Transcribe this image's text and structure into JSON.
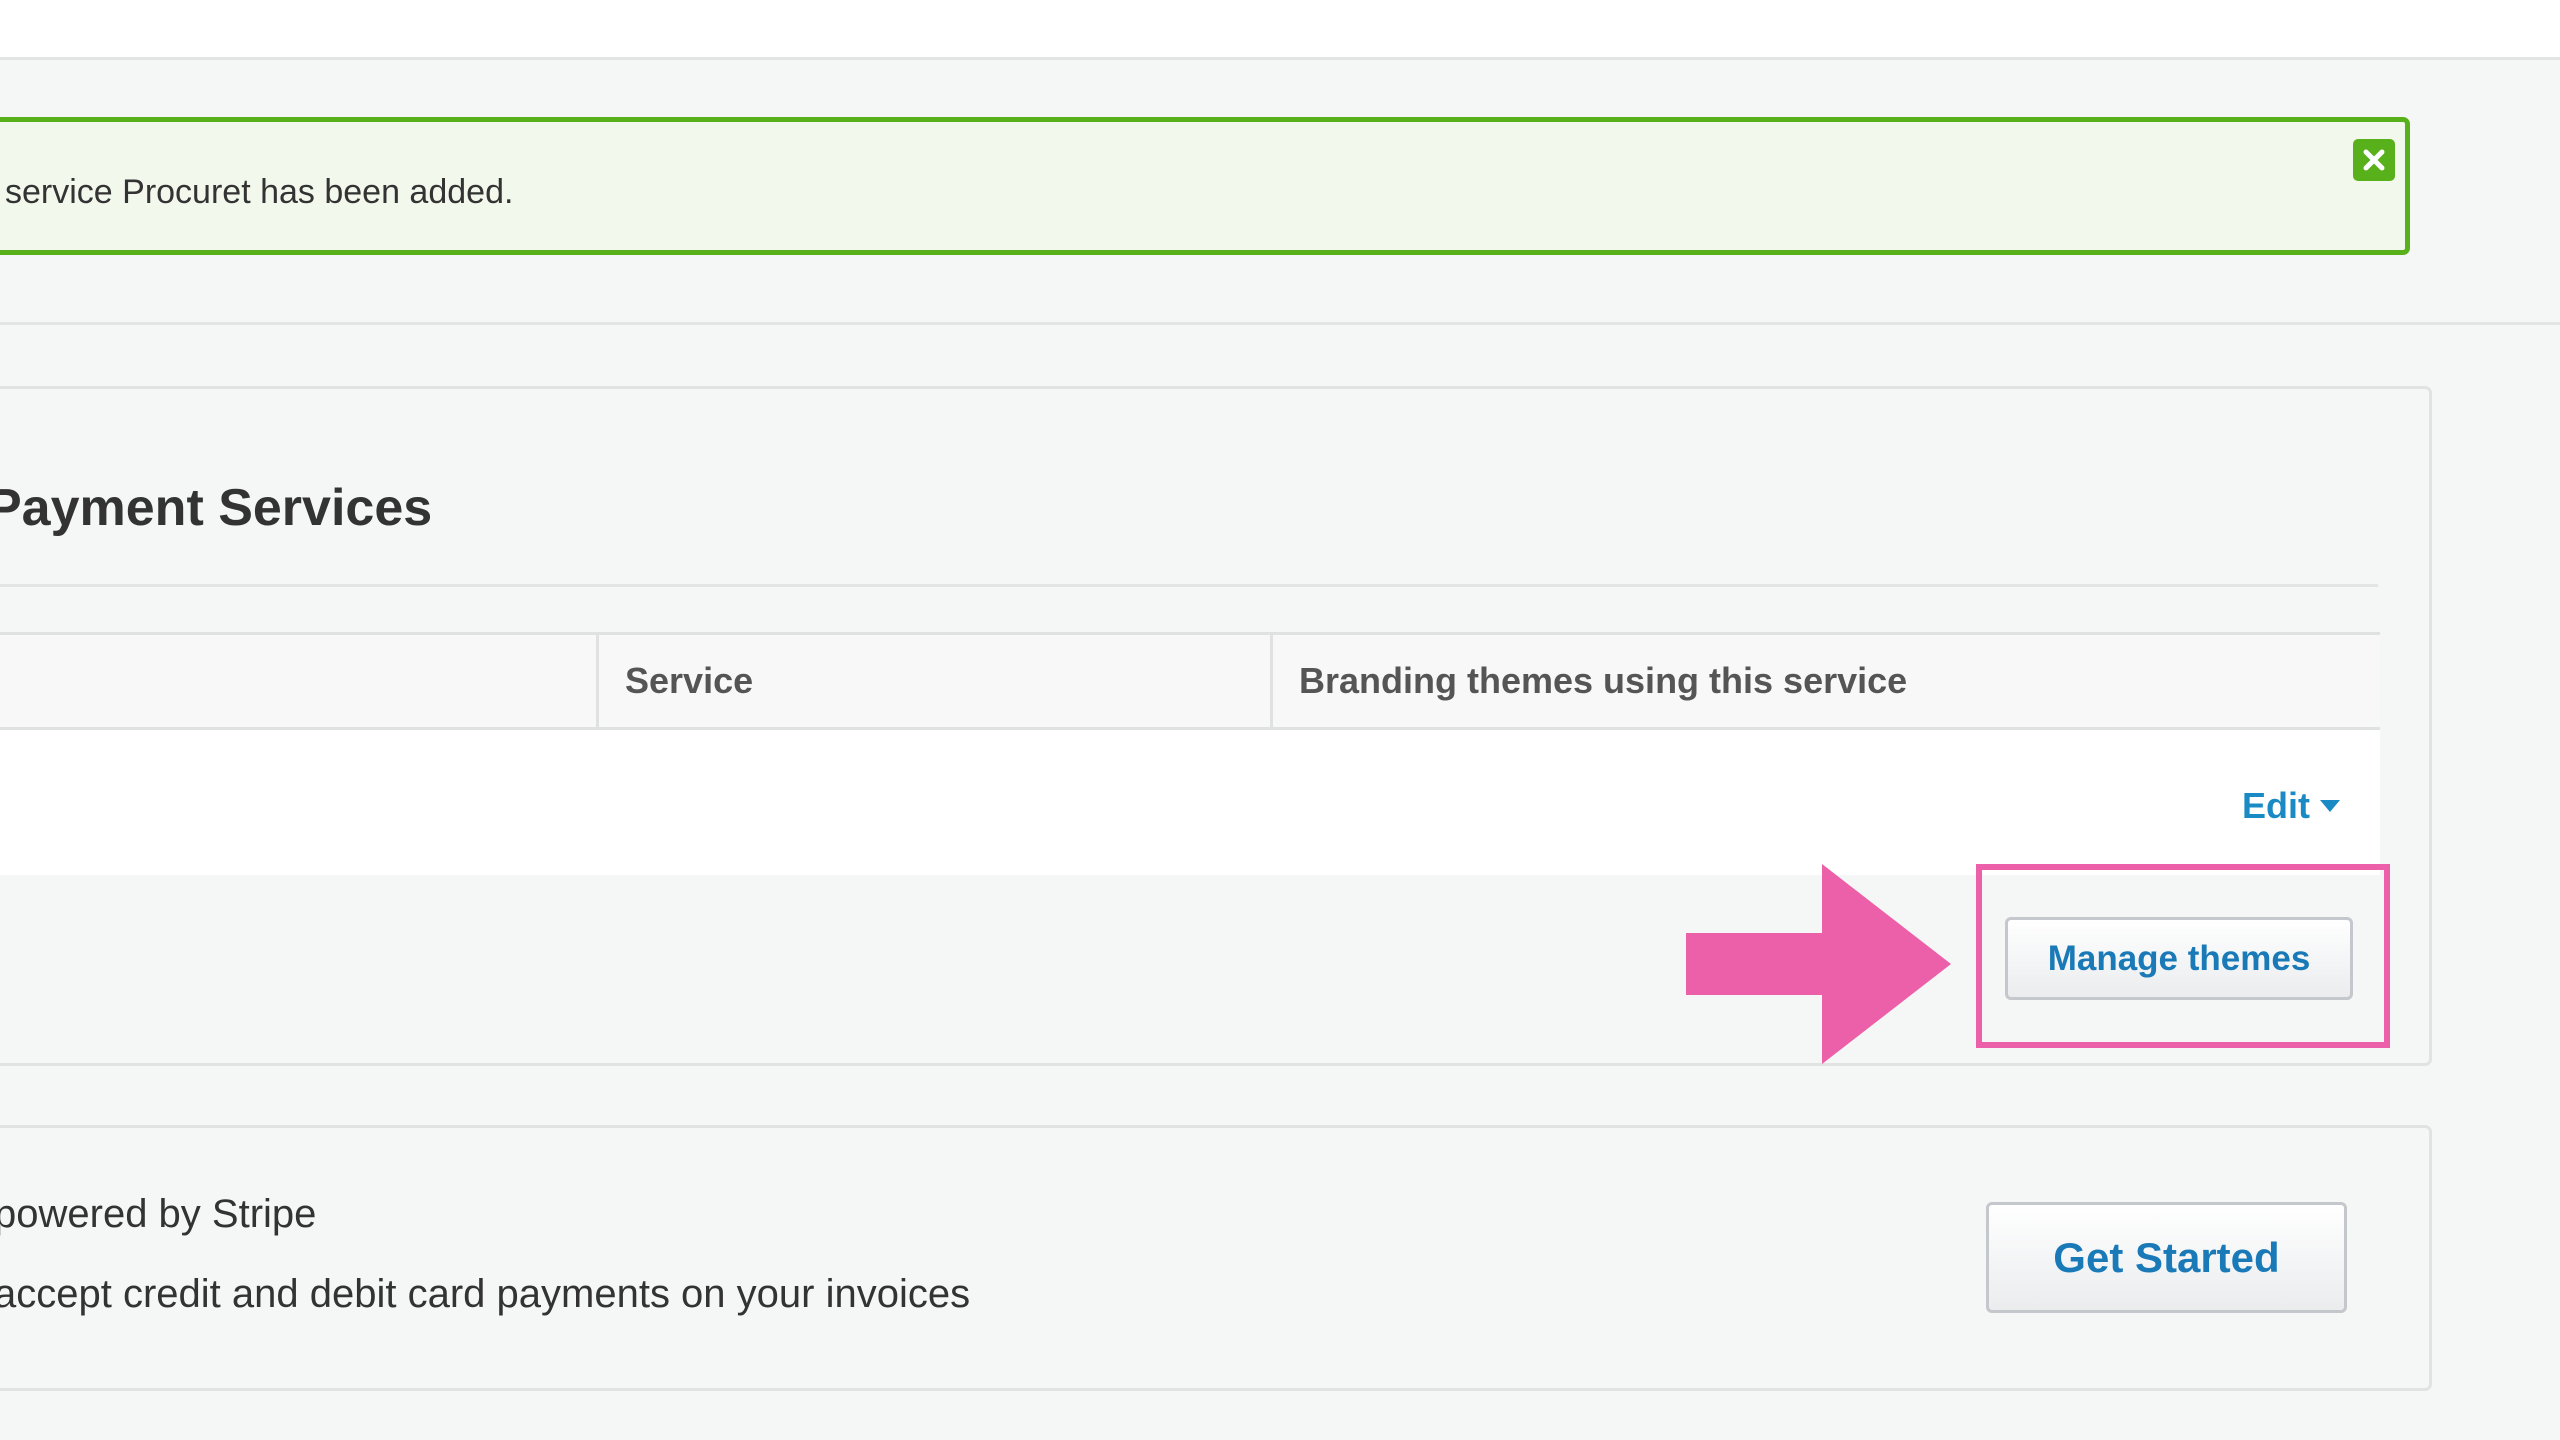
{
  "notification": {
    "message": "service Procuret has been added.",
    "color": "#58b01a"
  },
  "payment_services": {
    "title": "Payment Services",
    "columns": [
      "",
      "Service",
      "Branding themes using this service"
    ],
    "edit_label": "Edit",
    "manage_themes_label": "Manage themes"
  },
  "stripe": {
    "title": "powered by Stripe",
    "description": "accept credit and debit card payments on your invoices",
    "cta_label": "Get Started"
  },
  "annotation": {
    "color": "#ec5fa9",
    "target": "Manage themes"
  },
  "colors": {
    "link": "#1a8ac4",
    "success": "#58b01a",
    "page_bg": "#f5f7f6"
  }
}
